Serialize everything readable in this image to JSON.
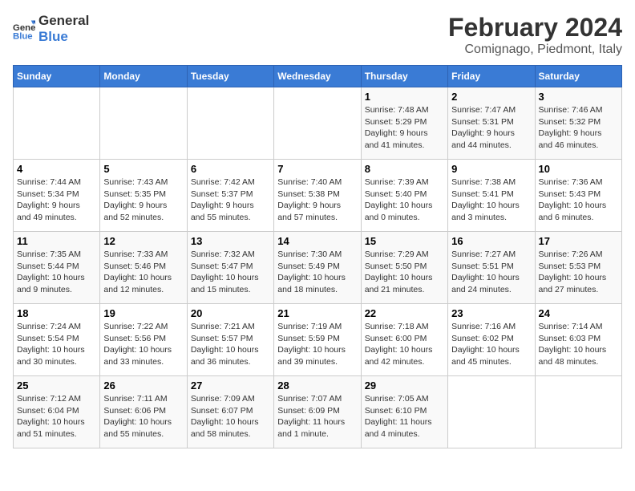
{
  "header": {
    "logo_general": "General",
    "logo_blue": "Blue",
    "main_title": "February 2024",
    "subtitle": "Comignago, Piedmont, Italy"
  },
  "weekdays": [
    "Sunday",
    "Monday",
    "Tuesday",
    "Wednesday",
    "Thursday",
    "Friday",
    "Saturday"
  ],
  "weeks": [
    [
      {
        "day": "",
        "info": ""
      },
      {
        "day": "",
        "info": ""
      },
      {
        "day": "",
        "info": ""
      },
      {
        "day": "",
        "info": ""
      },
      {
        "day": "1",
        "info": "Sunrise: 7:48 AM\nSunset: 5:29 PM\nDaylight: 9 hours\nand 41 minutes."
      },
      {
        "day": "2",
        "info": "Sunrise: 7:47 AM\nSunset: 5:31 PM\nDaylight: 9 hours\nand 44 minutes."
      },
      {
        "day": "3",
        "info": "Sunrise: 7:46 AM\nSunset: 5:32 PM\nDaylight: 9 hours\nand 46 minutes."
      }
    ],
    [
      {
        "day": "4",
        "info": "Sunrise: 7:44 AM\nSunset: 5:34 PM\nDaylight: 9 hours\nand 49 minutes."
      },
      {
        "day": "5",
        "info": "Sunrise: 7:43 AM\nSunset: 5:35 PM\nDaylight: 9 hours\nand 52 minutes."
      },
      {
        "day": "6",
        "info": "Sunrise: 7:42 AM\nSunset: 5:37 PM\nDaylight: 9 hours\nand 55 minutes."
      },
      {
        "day": "7",
        "info": "Sunrise: 7:40 AM\nSunset: 5:38 PM\nDaylight: 9 hours\nand 57 minutes."
      },
      {
        "day": "8",
        "info": "Sunrise: 7:39 AM\nSunset: 5:40 PM\nDaylight: 10 hours\nand 0 minutes."
      },
      {
        "day": "9",
        "info": "Sunrise: 7:38 AM\nSunset: 5:41 PM\nDaylight: 10 hours\nand 3 minutes."
      },
      {
        "day": "10",
        "info": "Sunrise: 7:36 AM\nSunset: 5:43 PM\nDaylight: 10 hours\nand 6 minutes."
      }
    ],
    [
      {
        "day": "11",
        "info": "Sunrise: 7:35 AM\nSunset: 5:44 PM\nDaylight: 10 hours\nand 9 minutes."
      },
      {
        "day": "12",
        "info": "Sunrise: 7:33 AM\nSunset: 5:46 PM\nDaylight: 10 hours\nand 12 minutes."
      },
      {
        "day": "13",
        "info": "Sunrise: 7:32 AM\nSunset: 5:47 PM\nDaylight: 10 hours\nand 15 minutes."
      },
      {
        "day": "14",
        "info": "Sunrise: 7:30 AM\nSunset: 5:49 PM\nDaylight: 10 hours\nand 18 minutes."
      },
      {
        "day": "15",
        "info": "Sunrise: 7:29 AM\nSunset: 5:50 PM\nDaylight: 10 hours\nand 21 minutes."
      },
      {
        "day": "16",
        "info": "Sunrise: 7:27 AM\nSunset: 5:51 PM\nDaylight: 10 hours\nand 24 minutes."
      },
      {
        "day": "17",
        "info": "Sunrise: 7:26 AM\nSunset: 5:53 PM\nDaylight: 10 hours\nand 27 minutes."
      }
    ],
    [
      {
        "day": "18",
        "info": "Sunrise: 7:24 AM\nSunset: 5:54 PM\nDaylight: 10 hours\nand 30 minutes."
      },
      {
        "day": "19",
        "info": "Sunrise: 7:22 AM\nSunset: 5:56 PM\nDaylight: 10 hours\nand 33 minutes."
      },
      {
        "day": "20",
        "info": "Sunrise: 7:21 AM\nSunset: 5:57 PM\nDaylight: 10 hours\nand 36 minutes."
      },
      {
        "day": "21",
        "info": "Sunrise: 7:19 AM\nSunset: 5:59 PM\nDaylight: 10 hours\nand 39 minutes."
      },
      {
        "day": "22",
        "info": "Sunrise: 7:18 AM\nSunset: 6:00 PM\nDaylight: 10 hours\nand 42 minutes."
      },
      {
        "day": "23",
        "info": "Sunrise: 7:16 AM\nSunset: 6:02 PM\nDaylight: 10 hours\nand 45 minutes."
      },
      {
        "day": "24",
        "info": "Sunrise: 7:14 AM\nSunset: 6:03 PM\nDaylight: 10 hours\nand 48 minutes."
      }
    ],
    [
      {
        "day": "25",
        "info": "Sunrise: 7:12 AM\nSunset: 6:04 PM\nDaylight: 10 hours\nand 51 minutes."
      },
      {
        "day": "26",
        "info": "Sunrise: 7:11 AM\nSunset: 6:06 PM\nDaylight: 10 hours\nand 55 minutes."
      },
      {
        "day": "27",
        "info": "Sunrise: 7:09 AM\nSunset: 6:07 PM\nDaylight: 10 hours\nand 58 minutes."
      },
      {
        "day": "28",
        "info": "Sunrise: 7:07 AM\nSunset: 6:09 PM\nDaylight: 11 hours\nand 1 minute."
      },
      {
        "day": "29",
        "info": "Sunrise: 7:05 AM\nSunset: 6:10 PM\nDaylight: 11 hours\nand 4 minutes."
      },
      {
        "day": "",
        "info": ""
      },
      {
        "day": "",
        "info": ""
      }
    ]
  ]
}
